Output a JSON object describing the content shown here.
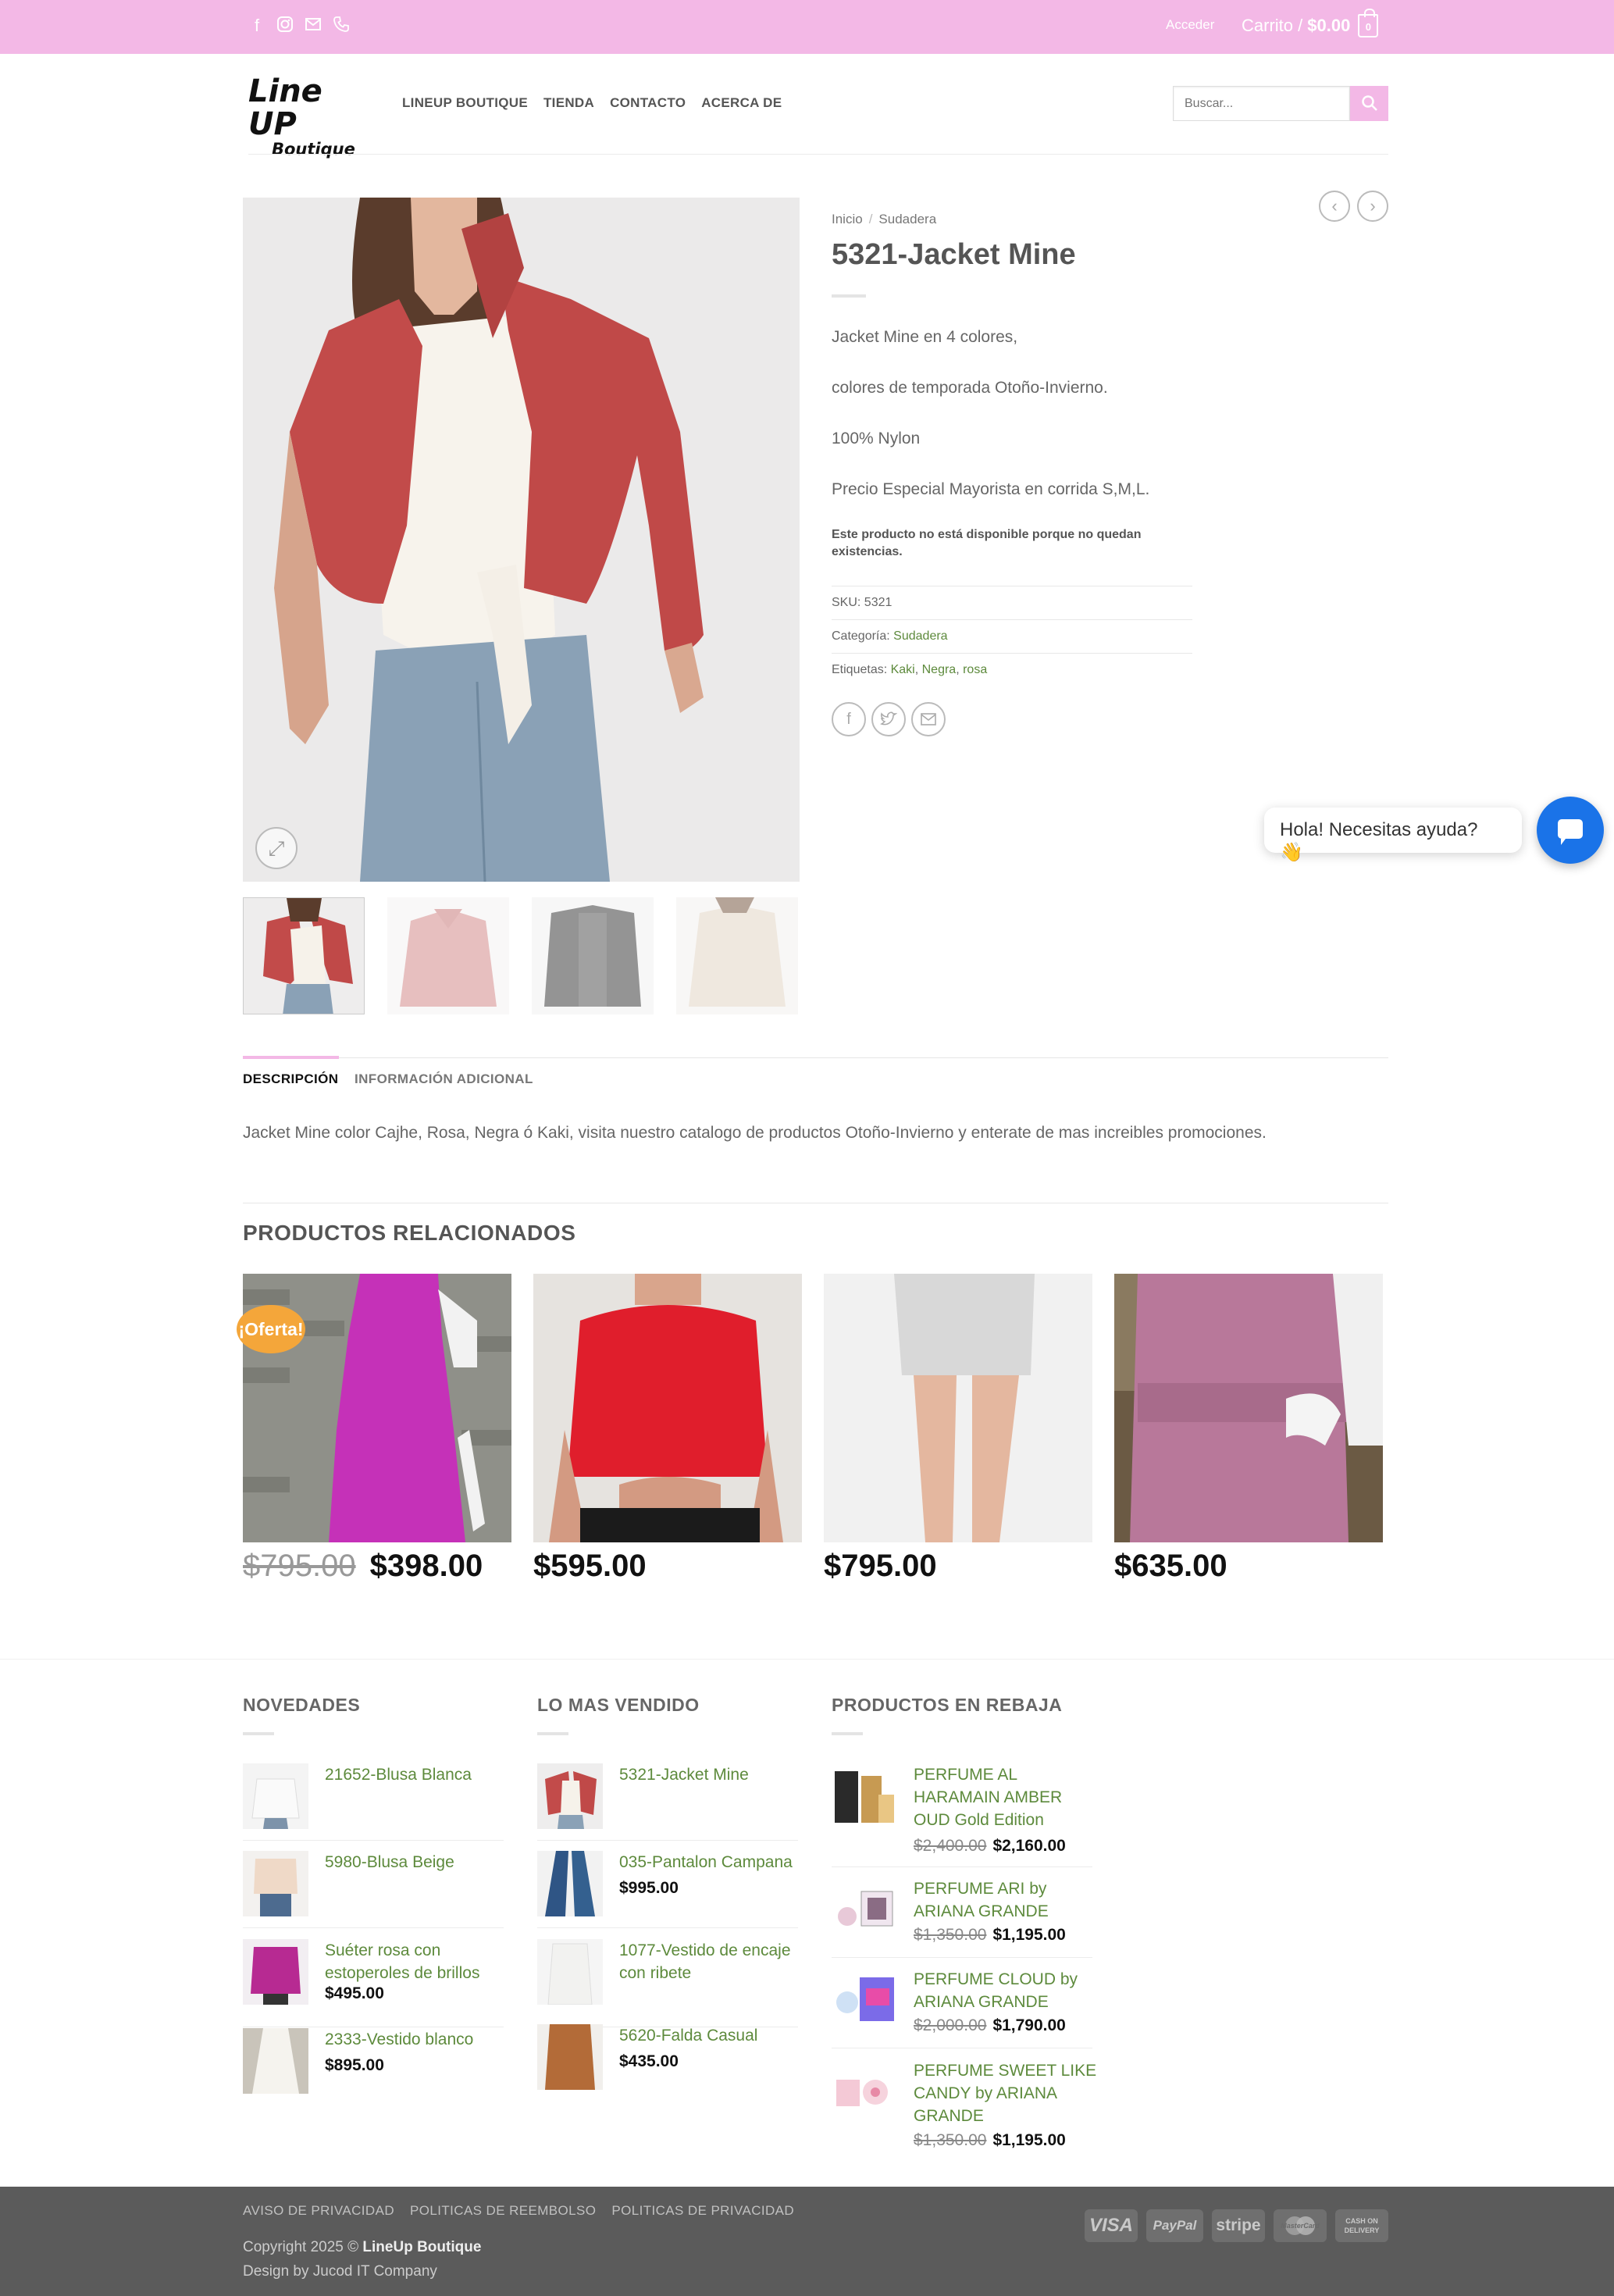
{
  "topbar": {
    "social_icons": [
      "facebook-icon",
      "instagram-icon",
      "envelope-icon",
      "phone-icon"
    ],
    "login": "Acceder",
    "cart_label": "Carrito /",
    "cart_total": "$0.00",
    "cart_count": "0"
  },
  "header": {
    "logo_line1": "Line UP",
    "logo_line2": "Boutique",
    "nav": [
      "LINEUP BOUTIQUE",
      "TIENDA",
      "CONTACTO",
      "ACERCA DE"
    ],
    "search_placeholder": "Buscar..."
  },
  "product": {
    "breadcrumb": [
      "Inicio",
      "Sudadera"
    ],
    "title": "5321-Jacket Mine",
    "description": [
      "Jacket Mine en 4 colores,",
      "colores de temporada Otoño-Invierno.",
      "100% Nylon",
      "Precio Especial Mayorista en corrida S,M,L."
    ],
    "stock_notice": "Este producto no está disponible porque no quedan existencias.",
    "sku_label": "SKU:",
    "sku": "5321",
    "category_label": "Categoría:",
    "category": "Sudadera",
    "tags_label": "Etiquetas:",
    "tags": [
      "Kaki",
      "Negra",
      "rosa"
    ]
  },
  "chat": {
    "message": "Hola! Necesitas ayuda? 👋"
  },
  "tabs": {
    "items": [
      "DESCRIPCIÓN",
      "INFORMACIÓN ADICIONAL"
    ],
    "content": "Jacket Mine color Cajhe, Rosa, Negra ó Kaki, visita nuestro catalogo de productos Otoño-Invierno y enterate de mas increibles promociones."
  },
  "related": {
    "title": "PRODUCTOS RELACIONADOS",
    "sale_badge": "¡Oferta!",
    "items": [
      {
        "old_price": "$795.00",
        "price": "$398.00"
      },
      {
        "old_price": "",
        "price": "$595.00"
      },
      {
        "old_price": "",
        "price": "$795.00"
      },
      {
        "old_price": "",
        "price": "$635.00"
      }
    ]
  },
  "widgets": {
    "novedades": {
      "title": "NOVEDADES",
      "items": [
        {
          "name": "21652-Blusa Blanca",
          "price": ""
        },
        {
          "name": "5980-Blusa Beige",
          "price": ""
        },
        {
          "name": "Suéter rosa con estoperoles de brillos",
          "price": "$495.00"
        },
        {
          "name": "2333-Vestido blanco",
          "price": "$895.00"
        }
      ]
    },
    "vendido": {
      "title": "LO MAS VENDIDO",
      "items": [
        {
          "name": "5321-Jacket Mine",
          "price": ""
        },
        {
          "name": "035-Pantalon Campana",
          "price": "$995.00"
        },
        {
          "name": "1077-Vestido de encaje con ribete",
          "price": ""
        },
        {
          "name": "5620-Falda Casual",
          "price": "$435.00"
        }
      ]
    },
    "rebaja": {
      "title": "PRODUCTOS EN REBAJA",
      "items": [
        {
          "name": "PERFUME AL HARAMAIN AMBER OUD Gold Edition",
          "old_price": "$2,400.00",
          "price": "$2,160.00"
        },
        {
          "name": "PERFUME ARI by ARIANA GRANDE",
          "old_price": "$1,350.00",
          "price": "$1,195.00"
        },
        {
          "name": "PERFUME CLOUD by ARIANA GRANDE",
          "old_price": "$2,000.00",
          "price": "$1,790.00"
        },
        {
          "name": "PERFUME SWEET LIKE CANDY by ARIANA GRANDE",
          "old_price": "$1,350.00",
          "price": "$1,195.00"
        }
      ]
    }
  },
  "footer": {
    "links": [
      "AVISO DE PRIVACIDAD",
      "POLITICAS DE REEMBOLSO",
      "POLITICAS DE PRIVACIDAD"
    ],
    "copyright_prefix": "Copyright 2025 ©",
    "copyright_brand": "LineUp Boutique",
    "credit": "Design by Jucod IT Company",
    "payments": [
      "VISA",
      "PayPal",
      "stripe",
      "MasterCard",
      "CASH ON DELIVERY"
    ]
  },
  "colors": {
    "accent_pink": "#f3b8e6",
    "link_green": "#5d8a3c",
    "badge_orange": "#f4a63a",
    "chat_blue": "#1a73e8",
    "footer_gray": "#5b5b5b"
  }
}
